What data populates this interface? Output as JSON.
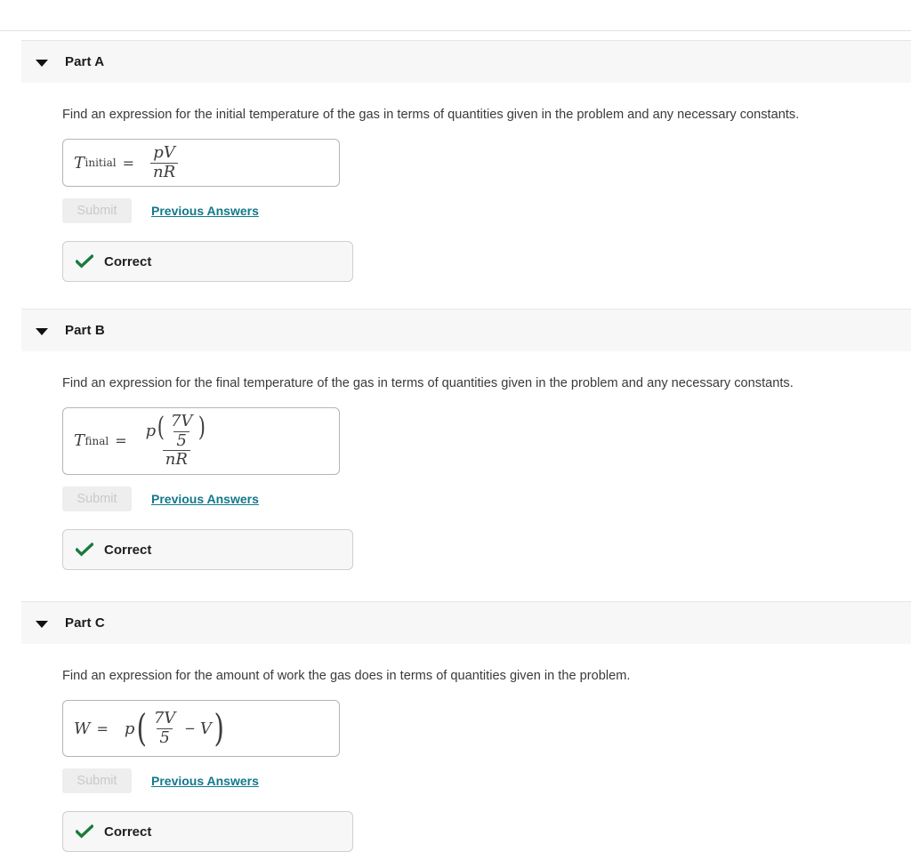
{
  "page": {
    "background": "#ffffff",
    "link_color": "#12788c",
    "check_color": "#1a7a3c",
    "header_band_color": "#f7f7f7"
  },
  "parts": [
    {
      "id": "part-a",
      "title": "Part A",
      "caret_icon": "caret-down-icon",
      "prompt": "Find an expression for the initial temperature of the gas in terms of quantities given in the problem and any necessary constants.",
      "answer": {
        "lhs_var": "T",
        "lhs_sub": "initial",
        "equals": "=",
        "expression_text": "pV / nR",
        "numerator": "pV",
        "denominator": "nR"
      },
      "submit_label": "Submit",
      "submit_disabled": true,
      "previous_answers_label": "Previous Answers",
      "status": {
        "icon": "check-icon",
        "label": "Correct"
      }
    },
    {
      "id": "part-b",
      "title": "Part B",
      "caret_icon": "caret-down-icon",
      "prompt": "Find an expression for the final temperature of the gas in terms of quantities given in the problem and any necessary constants.",
      "answer": {
        "lhs_var": "T",
        "lhs_sub": "final",
        "equals": "=",
        "expression_text": "p(7V/5) / nR",
        "outer_numerator_var": "p",
        "inner_numerator": "7V",
        "inner_denominator": "5",
        "denominator": "nR",
        "paren_open": "(",
        "paren_close": ")"
      },
      "submit_label": "Submit",
      "submit_disabled": true,
      "previous_answers_label": "Previous Answers",
      "status": {
        "icon": "check-icon",
        "label": "Correct"
      }
    },
    {
      "id": "part-c",
      "title": "Part C",
      "caret_icon": "caret-down-icon",
      "prompt": "Find an expression for the amount of work the gas does in terms of quantities given in the problem.",
      "answer": {
        "lhs_var": "W",
        "lhs_sub": "",
        "equals": "=",
        "expression_text": "p(7V/5 - V)",
        "outer_var": "p",
        "inner_numerator": "7V",
        "inner_denominator": "5",
        "operator": "−",
        "trailing_var": "V",
        "paren_open": "(",
        "paren_close": ")"
      },
      "submit_label": "Submit",
      "submit_disabled": true,
      "previous_answers_label": "Previous Answers",
      "status": {
        "icon": "check-icon",
        "label": "Correct"
      }
    }
  ]
}
